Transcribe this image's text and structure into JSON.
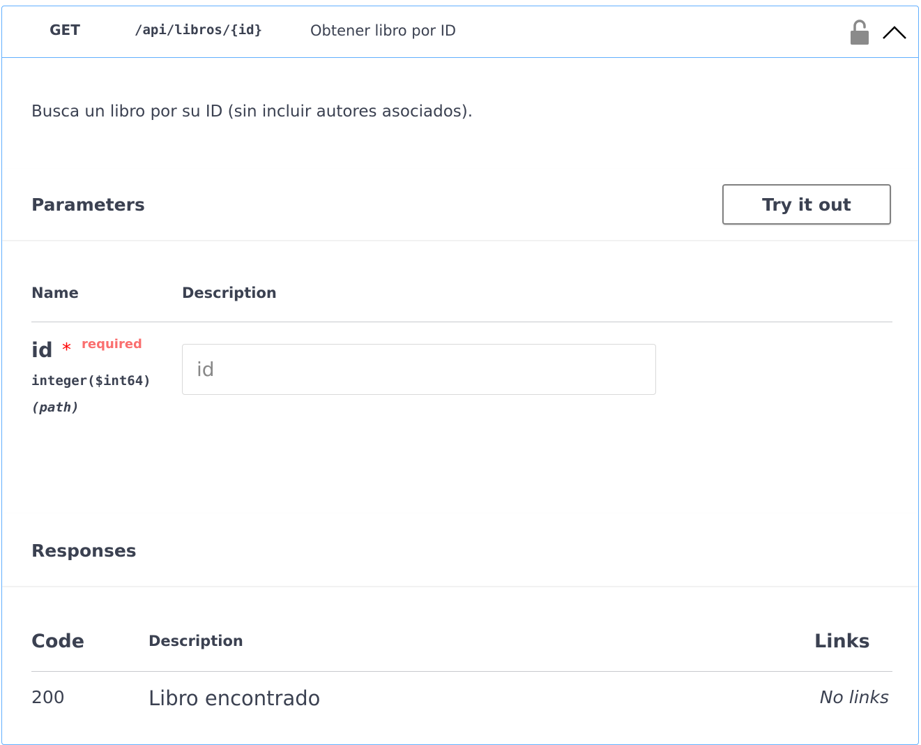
{
  "operation": {
    "method": "GET",
    "path": "/api/libros/{id}",
    "summary": "Obtener libro por ID",
    "description": "Busca un libro por su ID (sin incluir autores asociados).",
    "accent_color": "#61affe",
    "icons": [
      "lock-icon",
      "chevron-up-icon"
    ]
  },
  "parameters": {
    "title": "Parameters",
    "try_it_out_label": "Try it out",
    "columns": {
      "name": "Name",
      "description": "Description"
    },
    "items": [
      {
        "name": "id",
        "required_star": "*",
        "required_label": "required",
        "type": "integer",
        "format": "($int64)",
        "in": "(path)",
        "placeholder": "id",
        "value": ""
      }
    ]
  },
  "responses": {
    "title": "Responses",
    "columns": {
      "code": "Code",
      "description": "Description",
      "links": "Links"
    },
    "items": [
      {
        "code": "200",
        "description": "Libro encontrado",
        "links": "No links"
      }
    ]
  }
}
